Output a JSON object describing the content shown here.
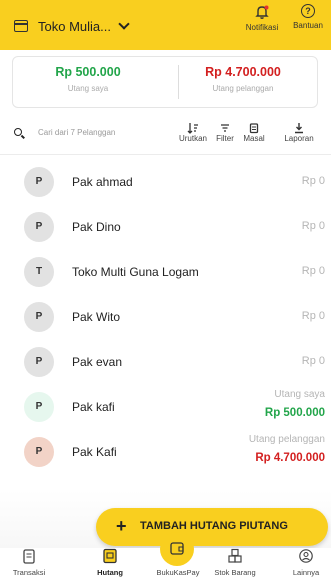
{
  "header": {
    "store_name": "Toko Mulia...",
    "notif_label": "Notifikasi",
    "help_label": "Bantuan",
    "help_glyph": "?"
  },
  "summary": {
    "my_debt_amount": "Rp 500.000",
    "my_debt_label": "Utang saya",
    "customer_debt_amount": "Rp 4.700.000",
    "customer_debt_label": "Utang pelanggan"
  },
  "toolbar": {
    "search_placeholder": "Cari dari 7 Pelanggan",
    "sort_label": "Urutkan",
    "filter_label": "Filter",
    "bulk_label": "Masal",
    "report_label": "Laporan"
  },
  "customers": [
    {
      "initial": "P",
      "name": "Pak ahmad",
      "amount": "Rp 0"
    },
    {
      "initial": "P",
      "name": "Pak Dino",
      "amount": "Rp 0"
    },
    {
      "initial": "T",
      "name": "Toko Multi Guna Logam",
      "amount": "Rp 0"
    },
    {
      "initial": "P",
      "name": "Pak Wito",
      "amount": "Rp 0"
    },
    {
      "initial": "P",
      "name": "Pak evan",
      "amount": "Rp 0"
    },
    {
      "initial": "P",
      "name": "Pak kafi",
      "sub": "Utang saya",
      "amount": "Rp 500.000"
    },
    {
      "initial": "P",
      "name": "Pak Kafi",
      "sub": "Utang pelanggan",
      "amount": "Rp 4.700.000"
    }
  ],
  "fab": {
    "plus": "+",
    "label": "TAMBAH HUTANG PIUTANG"
  },
  "nav": {
    "items": [
      {
        "label": "Transaksi"
      },
      {
        "label": "Hutang"
      },
      {
        "label": "BukuKasPay"
      },
      {
        "label": "Stok Barang"
      },
      {
        "label": "Lainnya"
      }
    ]
  },
  "colors": {
    "brand_yellow": "#f9cf1f",
    "positive_green": "#22a54a",
    "negative_red": "#d32020",
    "avatar_green": "#e6f7ee",
    "avatar_red": "#f2d3c7"
  }
}
